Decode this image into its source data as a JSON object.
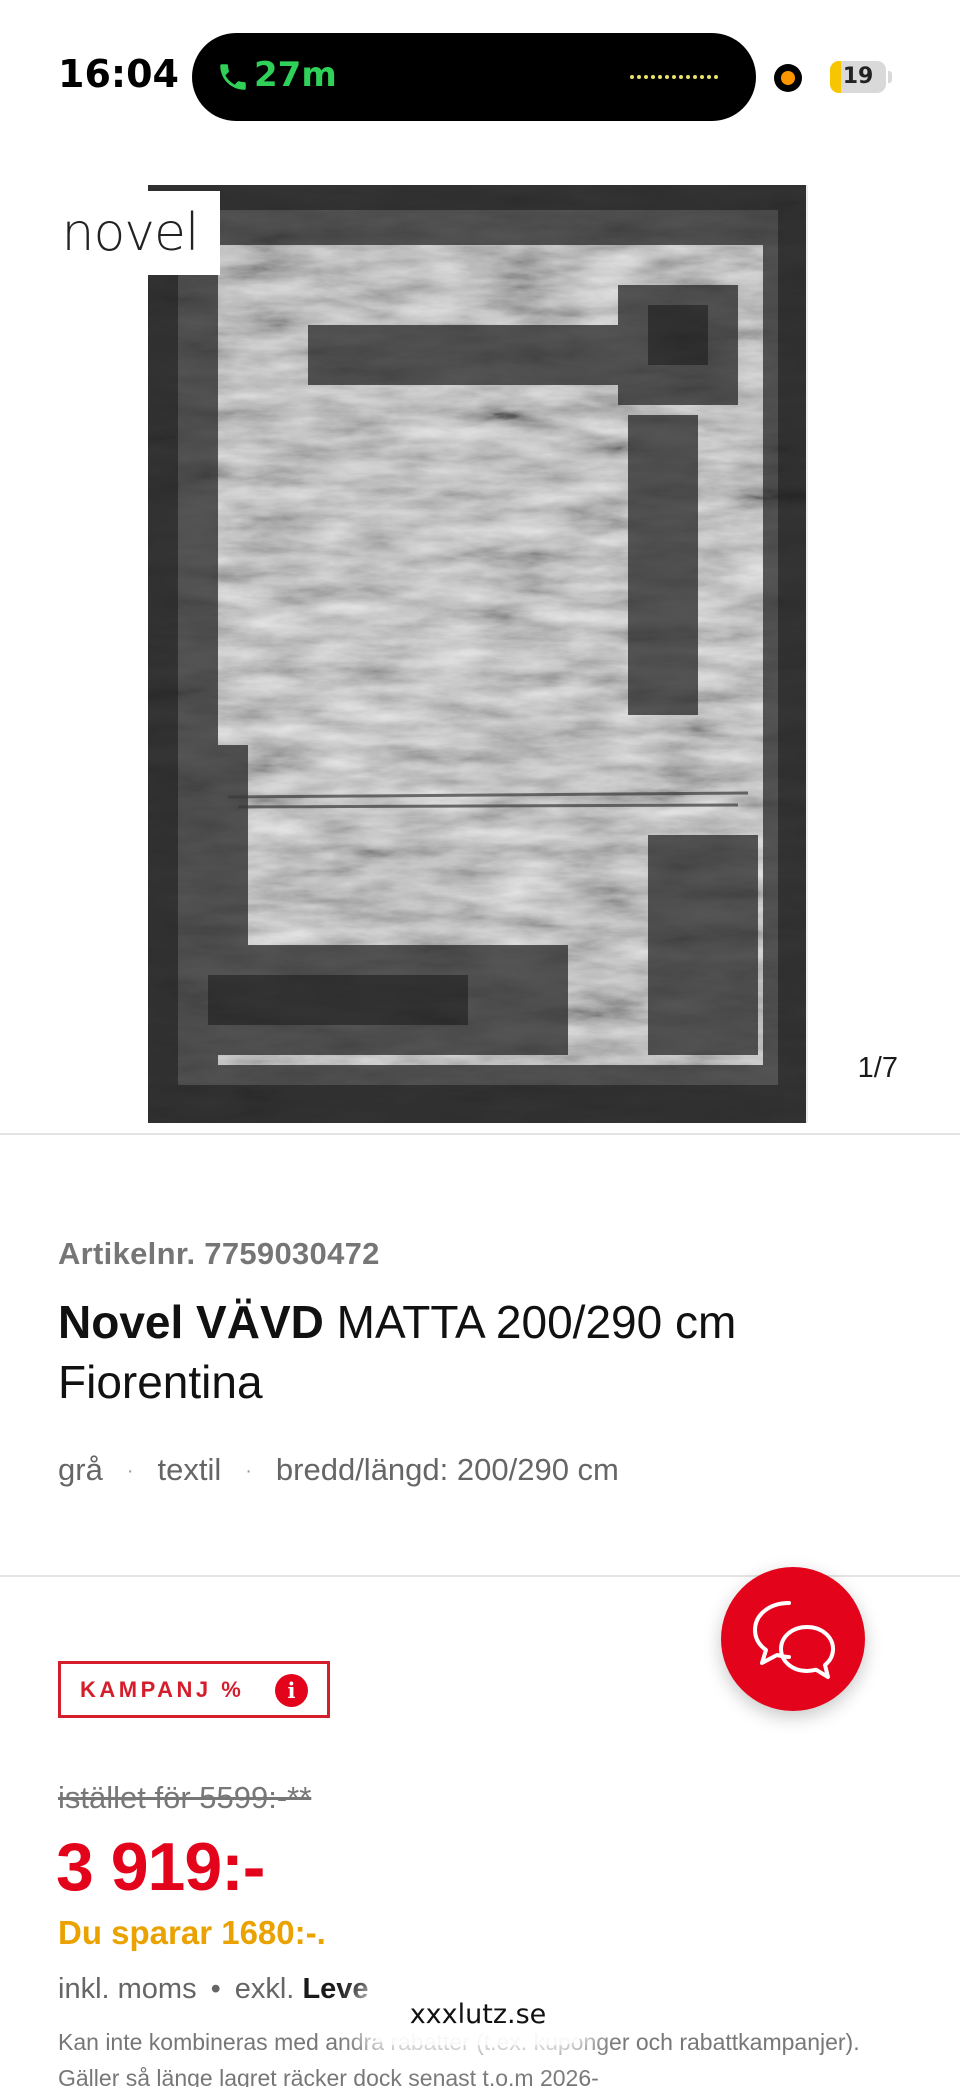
{
  "status_bar": {
    "time": "16:04",
    "call_duration": "27m",
    "call_color": "#30d158",
    "battery_level": "19",
    "battery_fraction": 0.19,
    "recording_indicator_color": "#ff9500"
  },
  "gallery": {
    "brand_logo_text": "novel",
    "image_counter": "1/7",
    "image_subject": "grey abstract woven rug"
  },
  "product": {
    "article_number": "Artikelnr. 7759030472",
    "title_brand": "Novel VÄVD",
    "title_rest": " MATTA 200/290 cm Fiorentina",
    "attributes": [
      "grå",
      "textil",
      "bredd/längd: 200/290 cm"
    ],
    "attribute_separator": "·"
  },
  "pricing": {
    "campaign_label": "KAMPANJ %",
    "campaign_info_icon": "i",
    "old_price": "istället för 5599:-**",
    "current_price": "3 919:-",
    "savings": "Du sparar 1680:-.",
    "tax_included": "inkl. moms",
    "bullet": "•",
    "delivery_excluded": "exkl.",
    "delivery_link": "Leve",
    "disclaimer": "Kan inte kombineras med andra rabatter (t.ex. kuponger och rabattkampanjer). Gäller så länge lagret räcker dock senast t.o.m 2026-"
  },
  "browser": {
    "url": "xxxlutz.se"
  },
  "colors": {
    "accent_red": "#e3041b",
    "campaign_red": "#d51e2c",
    "savings_yellow": "#eaa200",
    "muted_text": "#767676"
  },
  "icons": {
    "call": "phone-icon",
    "chat": "chat-bubbles-icon",
    "info": "info-icon"
  }
}
